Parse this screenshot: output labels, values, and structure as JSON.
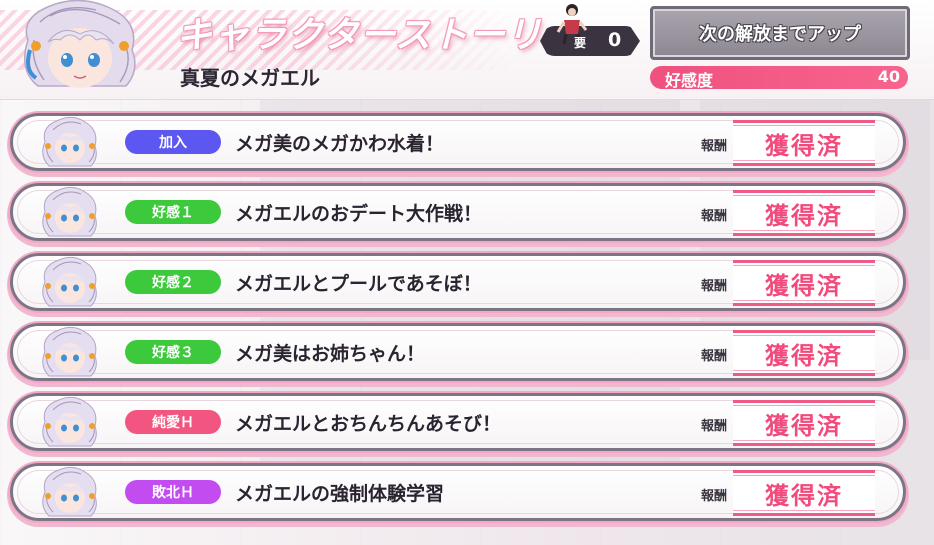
{
  "header": {
    "title": "キャラクターストーリー",
    "subtitle": "真夏のメガエル",
    "requirement": {
      "label": "要",
      "value": "0"
    },
    "unlock_button_label": "次の解放までアップ",
    "affinity": {
      "label": "好感度",
      "value": "40"
    }
  },
  "reward_label": "報酬",
  "stories": [
    {
      "tag": "加入",
      "tag_color": "#5b57f0",
      "title": "メガ美のメガかわ水着！",
      "status": "獲得済"
    },
    {
      "tag": "好感１",
      "tag_color": "#3cc93c",
      "title": "メガエルのおデート大作戦！",
      "status": "獲得済"
    },
    {
      "tag": "好感２",
      "tag_color": "#3cc93c",
      "title": "メガエルとプールであそぼ！",
      "status": "獲得済"
    },
    {
      "tag": "好感３",
      "tag_color": "#3cc93c",
      "title": "メガ美はお姉ちゃん！",
      "status": "獲得済"
    },
    {
      "tag": "純愛Ｈ",
      "tag_color": "#f2557f",
      "title": "メガエルとおちんちんあそび！",
      "status": "獲得済"
    },
    {
      "tag": "敗北Ｈ",
      "tag_color": "#c24cf0",
      "title": "メガエルの強制体験学習",
      "status": "獲得済"
    }
  ]
}
